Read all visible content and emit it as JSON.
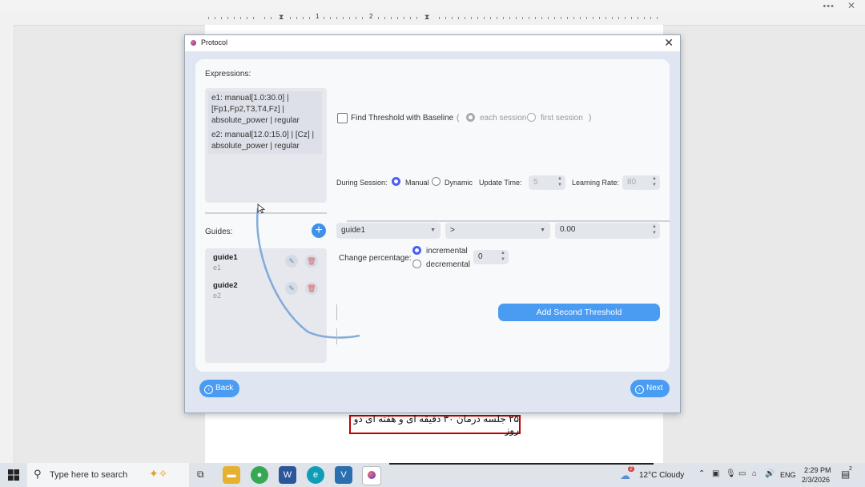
{
  "dialog": {
    "title": "Protocol",
    "close": "✕",
    "expressions_label": "Expressions:",
    "expressions": [
      "e1: manual[1.0:30.0] | [Fp1,Fp2,T3,T4,Fz] | absolute_power | regular",
      "e2: manual[12.0:15.0] | [Cz] | absolute_power | regular"
    ],
    "guides_label": "Guides:",
    "guides": [
      {
        "name": "guide1",
        "expr": "e1"
      },
      {
        "name": "guide2",
        "expr": "e2"
      }
    ],
    "add_guide": "+",
    "find_threshold": "Find Threshold with Baseline",
    "paren_open": "(",
    "paren_close": ")",
    "each_session": "each session",
    "first_session": "first session",
    "during_session": "During Session:",
    "manual": "Manual",
    "dynamic": "Dynamic",
    "update_time_label": "Update Time:",
    "update_time_value": "5",
    "learning_rate_label": "Learning Rate:",
    "learning_rate_value": "80",
    "guide_combo": "guide1",
    "operator_combo": ">",
    "threshold_value": "0.00",
    "change_percentage": "Change percentage:",
    "incremental": "incremental",
    "decremental": "decremental",
    "change_value": "0",
    "add_second_threshold": "Add Second Threshold",
    "back": "Back",
    "next": "Next"
  },
  "document": {
    "persian_text": "۲۵ جلسه درمان ۳۰ دقیقه ای و هفته ای دو روز",
    "ruler_numbers": [
      "1",
      "2"
    ]
  },
  "taskbar": {
    "search_placeholder": "Type here to search",
    "weather": "12°C Cloudy",
    "weather_badge": "2",
    "language": "ENG",
    "time": "2:29 PM",
    "date": "2/3/2026",
    "notifications": "2"
  },
  "colors": {
    "accent": "#4a9cf2",
    "radio_selected": "#4a5ff0",
    "highlight_border": "#c00000"
  }
}
